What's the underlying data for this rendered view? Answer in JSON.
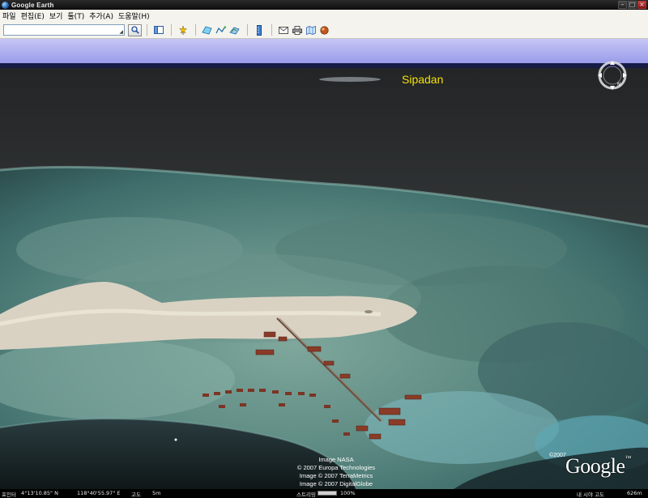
{
  "window": {
    "title": "Google Earth"
  },
  "menu": {
    "items": [
      "파일",
      "편집(E)",
      "보기",
      "툴(T)",
      "추가(A)",
      "도움말(H)"
    ]
  },
  "toolbar": {
    "search_value": "",
    "search_placeholder": ""
  },
  "map": {
    "place_label": "Sipadan",
    "credits": [
      "Image NASA",
      "© 2007 Europa Technologies",
      "Image © 2007 TerraMetrics",
      "Image © 2007 DigitalGlobe"
    ],
    "brand_copyright": "©2007",
    "brand_logo": "Google",
    "brand_tm": "™"
  },
  "status": {
    "pointer_label": "포인터",
    "latitude": "4°13'10.85\" N",
    "longitude": "118°40'55.97\" E",
    "elevation_label": "고도",
    "elevation": "5m",
    "streaming_label": "스트리밍",
    "streaming_percent": "100%",
    "streaming_fraction": 1.0,
    "eye_alt_label": "내 시야 고도",
    "eye_alt": "626m"
  },
  "colors": {
    "place_label": "#f3e10a",
    "sky": "#9c9cee",
    "deep_sea": "#2b2d2e"
  }
}
